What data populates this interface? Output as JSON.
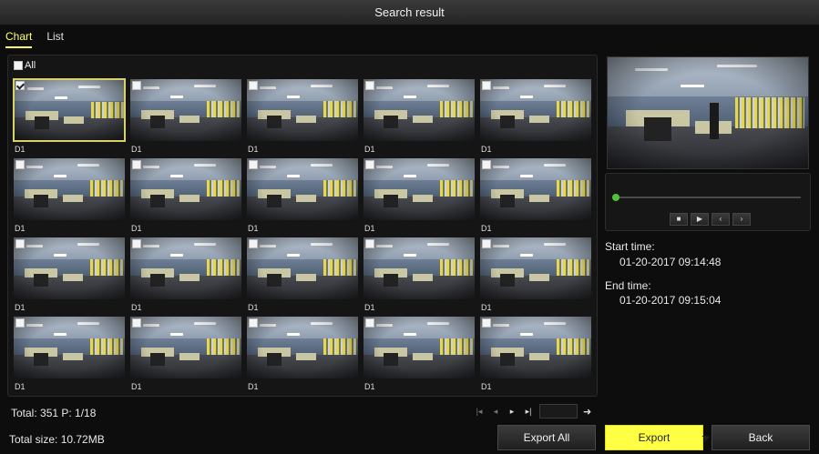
{
  "window": {
    "title": "Search result"
  },
  "tabs": [
    {
      "label": "Chart",
      "active": true
    },
    {
      "label": "List",
      "active": false
    }
  ],
  "grid": {
    "select_all_label": "All",
    "thumbnails": [
      {
        "label": "D1",
        "checked": true,
        "selected": true
      },
      {
        "label": "D1",
        "checked": false
      },
      {
        "label": "D1",
        "checked": false
      },
      {
        "label": "D1",
        "checked": false
      },
      {
        "label": "D1",
        "checked": false
      },
      {
        "label": "D1",
        "checked": false
      },
      {
        "label": "D1",
        "checked": false
      },
      {
        "label": "D1",
        "checked": false
      },
      {
        "label": "D1",
        "checked": false
      },
      {
        "label": "D1",
        "checked": false
      },
      {
        "label": "D1",
        "checked": false
      },
      {
        "label": "D1",
        "checked": false
      },
      {
        "label": "D1",
        "checked": false
      },
      {
        "label": "D1",
        "checked": false
      },
      {
        "label": "D1",
        "checked": false
      },
      {
        "label": "D1",
        "checked": false
      },
      {
        "label": "D1",
        "checked": false
      },
      {
        "label": "D1",
        "checked": false
      },
      {
        "label": "D1",
        "checked": false
      },
      {
        "label": "D1",
        "checked": false
      }
    ]
  },
  "playback": {
    "progress": 0.0,
    "controls": [
      "stop-icon",
      "play-icon",
      "step-back-icon",
      "step-forward-icon"
    ],
    "accent_color": "#3fa02c"
  },
  "info": {
    "start_label": "Start time:",
    "start_value": "01-20-2017 09:14:48",
    "end_label": "End time:",
    "end_value": "01-20-2017 09:15:04"
  },
  "footer": {
    "total_text": "Total: 351  P: 1/18",
    "size_text": "Total size: 10.72MB",
    "page_input_value": "",
    "buttons": {
      "export_all": "Export All",
      "export": "Export",
      "back": "Back"
    },
    "export_color": "#ffff44"
  }
}
